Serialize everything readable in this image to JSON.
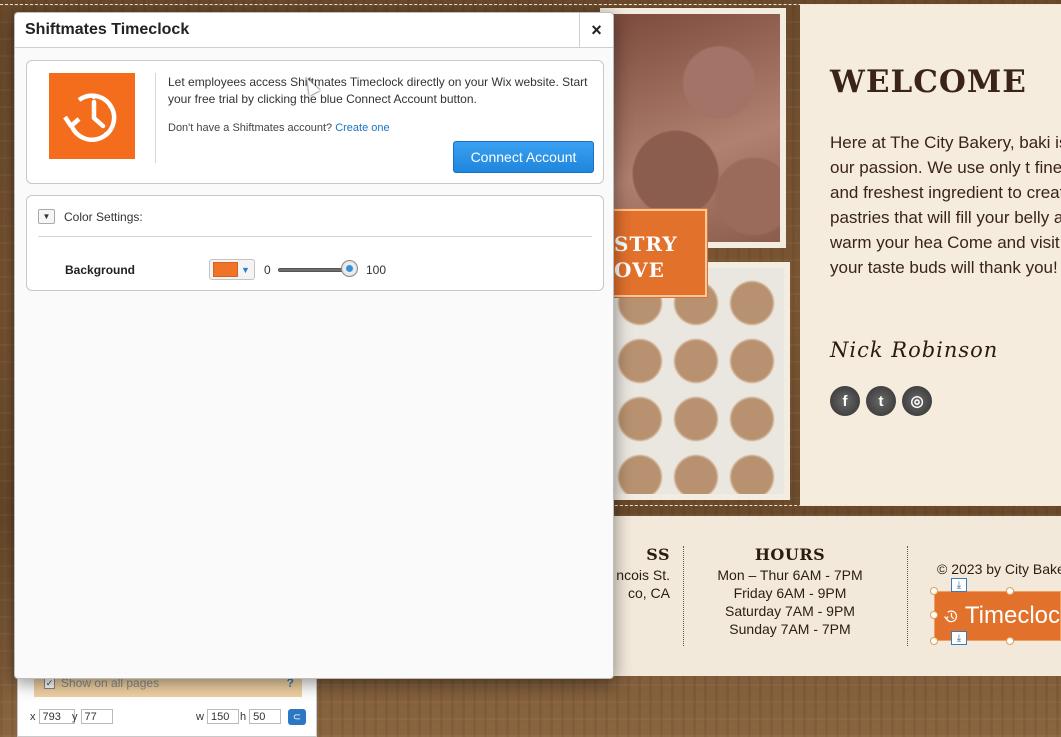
{
  "dialog": {
    "title": "Shiftmates Timeclock",
    "close_label": "×",
    "description": "Let employees access Shiftmates Timeclock directly on your Wix website. Start your free trial by clicking the blue Connect Account button.",
    "signup_prompt": "Don't have a Shiftmates account?",
    "signup_link": "Create one",
    "connect_label": "Connect Account",
    "color_settings": {
      "heading": "Color Settings:",
      "background_label": "Background",
      "background_color": "#f0732a",
      "opacity_min": "0",
      "opacity_max": "100",
      "opacity_value": 100
    }
  },
  "site": {
    "banner_line1": "STRY",
    "banner_line2": "OVE",
    "welcome_title": "WELCOME",
    "welcome_body": "Here at The City Bakery, baki is our passion. We use only t finest and freshest ingredient to create pastries that will fill your belly and warm your hea Come and visit - your taste buds will thank you!",
    "signature": "Nick Robinson",
    "socials": [
      "f",
      "t",
      "◎"
    ],
    "address_heading": "SS",
    "address_line1": "ncois St.",
    "address_line2": "co, CA",
    "hours_heading": "HOURS",
    "hours": [
      "Mon – Thur  6AM - 7PM",
      "Friday  6AM - 9PM",
      "Saturday  7AM - 9PM",
      "Sunday  7AM - 7PM"
    ],
    "copyright": "© 2023 by City Bake",
    "widget_label": "Timecloc"
  },
  "editor_panel": {
    "show_on_all_pages": "Show on all pages",
    "help": "?",
    "x_label": "x",
    "x_value": "793",
    "y_label": "y",
    "y_value": "77",
    "w_label": "w",
    "w_value": "150",
    "h_label": "h",
    "h_value": "50"
  },
  "colors": {
    "brand_orange": "#f36d1c",
    "connect_blue": "#1f86de",
    "link_blue": "#1a73c0"
  }
}
